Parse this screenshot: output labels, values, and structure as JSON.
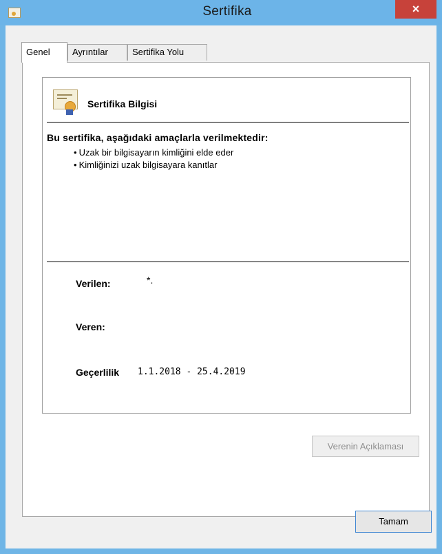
{
  "window": {
    "title": "Sertifika",
    "close_glyph": "×"
  },
  "tabs": [
    {
      "label": "Genel",
      "active": true
    },
    {
      "label": "Ayrıntılar",
      "active": false
    },
    {
      "label": "Sertifika Yolu",
      "active": false
    }
  ],
  "info": {
    "title": "Sertifika Bilgisi",
    "purpose_heading": "Bu sertifika, aşağıdaki amaçlarla verilmektedir:",
    "purposes": [
      "Uzak bir bilgisayarın kimliğini elde eder",
      "Kimliğinizi uzak bilgisayara kanıtlar"
    ],
    "issued_to_label": "Verilen:",
    "issued_to_value": "*.",
    "issued_by_label": "Veren:",
    "issued_by_value": "",
    "validity_label": "Geçerlilik",
    "validity_value": "1.1.2018 - 25.4.2019"
  },
  "buttons": {
    "issuer_statement": "Verenin Açıklaması",
    "ok": "Tamam"
  },
  "colors": {
    "titlebar": "#6cb4e8",
    "close": "#c7423a"
  },
  "icons": {
    "title": "certificate-icon",
    "info": "certificate-icon",
    "close": "close-icon"
  }
}
